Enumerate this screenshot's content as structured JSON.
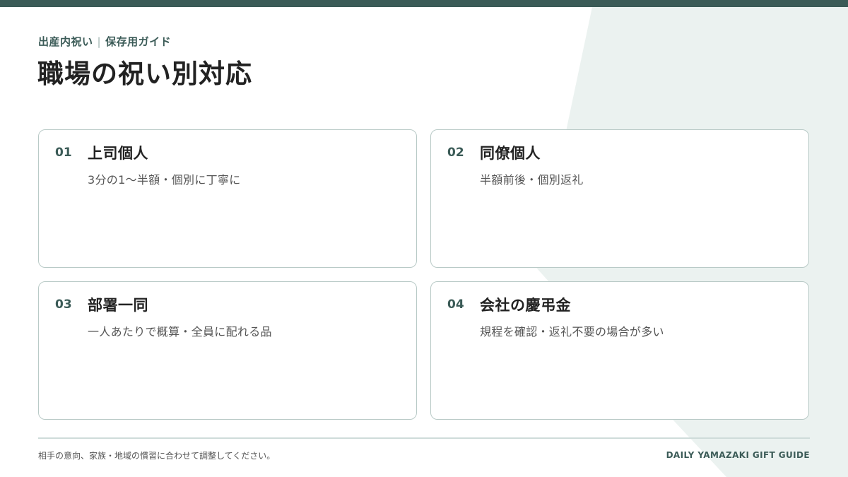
{
  "header": {
    "category": "出産内祝い",
    "subcategory": "保存用ガイド",
    "title": "職場の祝い別対応"
  },
  "cards": [
    {
      "number": "01",
      "title": "上司個人",
      "description": "3分の1〜半額・個別に丁寧に"
    },
    {
      "number": "02",
      "title": "同僚個人",
      "description": "半額前後・個別返礼"
    },
    {
      "number": "03",
      "title": "部署一同",
      "description": "一人あたりで概算・全員に配れる品"
    },
    {
      "number": "04",
      "title": "会社の慶弔金",
      "description": "規程を確認・返礼不要の場合が多い"
    }
  ],
  "footer": {
    "note": "相手の意向、家族・地域の慣習に合わせて調整してください。",
    "brand": "DAILY YAMAZAKI GIFT GUIDE"
  },
  "colors": {
    "accent": "#3b5b57",
    "background_shape": "#ebf2f0",
    "card_border": "#b9cac7"
  }
}
